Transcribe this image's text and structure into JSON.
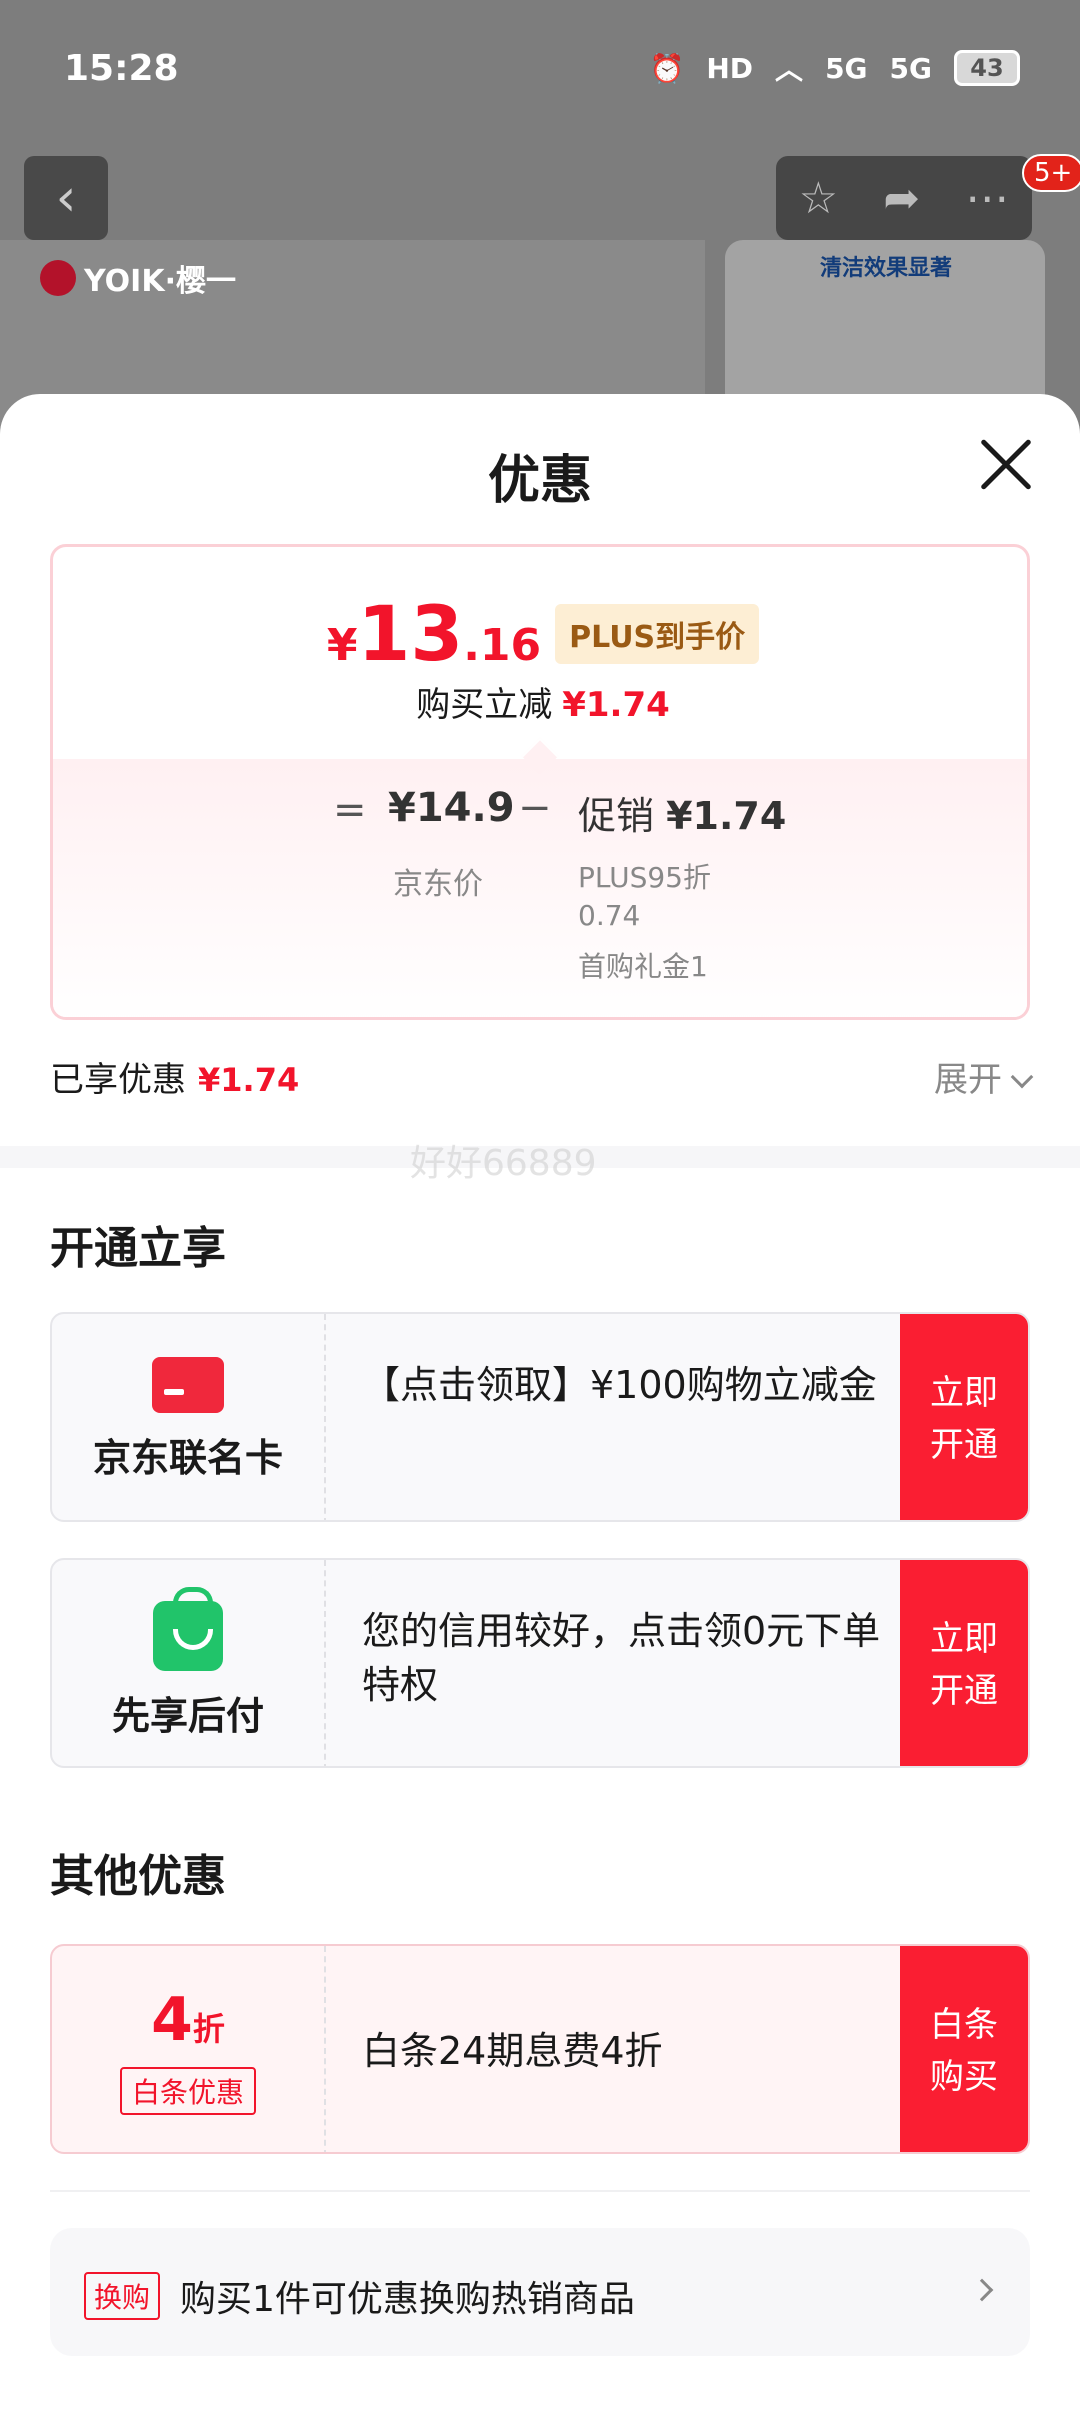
{
  "status_bar": {
    "time": "15:28",
    "hd_label": "HD",
    "signal1": "5G",
    "signal2": "5G",
    "battery": "43"
  },
  "background": {
    "brand": "YOIK·樱一",
    "tag": "清洁效果显著",
    "badge": "5+"
  },
  "sheet": {
    "title": "优惠",
    "price": {
      "yen": "¥",
      "int": "13",
      "dec": ".16",
      "plus_tag": "PLUS到手价",
      "reduce_label": "购买立减",
      "reduce_value": "¥1.74"
    },
    "breakdown": {
      "eq": "=",
      "jd_price": "¥14.9",
      "jd_label": "京东价",
      "minus": "−",
      "promo_label": "促销",
      "promo_value": "¥1.74",
      "promo_detail1": "PLUS95折 0.74",
      "promo_detail2": "首购礼金1"
    },
    "enjoyed_label": "已享优惠",
    "enjoyed_value": "¥1.74",
    "expand_label": "展开",
    "watermark": "好好66889"
  },
  "open_section": {
    "title": "开通立享",
    "offers": [
      {
        "name": "京东联名卡",
        "text": "【点击领取】¥100购物立减金",
        "button": "立即开通",
        "icon": "credit-card-icon"
      },
      {
        "name": "先享后付",
        "text": "您的信用较好，点击领0元下单特权",
        "button": "立即开通",
        "icon": "shopping-bag-icon"
      }
    ]
  },
  "other_section": {
    "title": "其他优惠",
    "offer": {
      "big": "4",
      "big_unit": "折",
      "tag": "白条优惠",
      "text": "白条24期息费4折",
      "button": "白条购买"
    }
  },
  "exchange": {
    "tag": "换购",
    "text": "购买1件可优惠换购热销商品"
  },
  "colors": {
    "accent_red": "#f2142b",
    "button_red": "#fa1e32",
    "plus_gold": "#9a5a14"
  }
}
